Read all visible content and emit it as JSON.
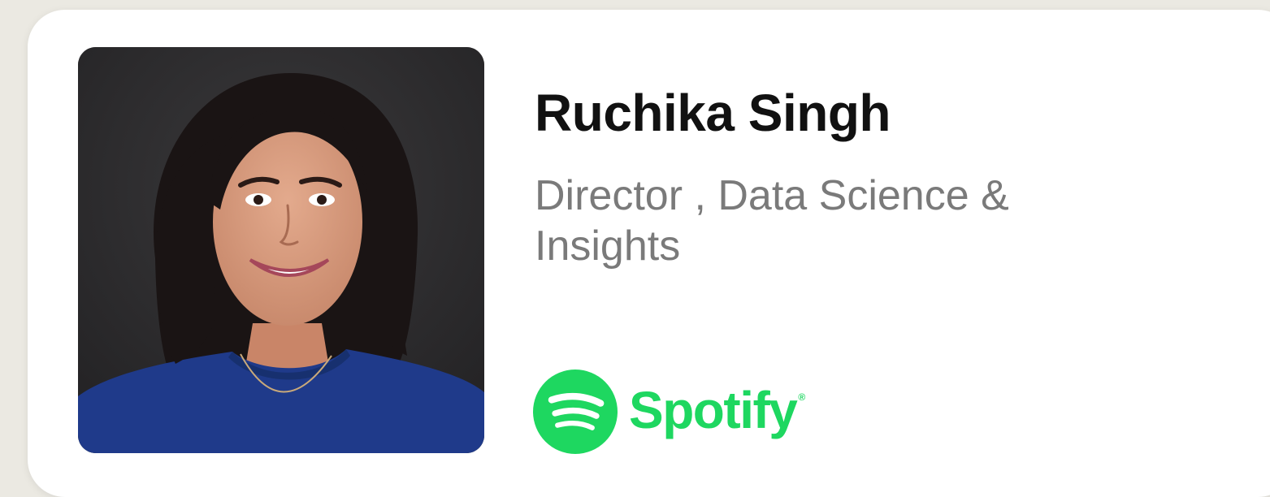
{
  "profile": {
    "name": "Ruchika Singh",
    "title": "Director , Data Science & Insights",
    "company": "Spotify",
    "company_logo_icon": "spotify-logo-icon",
    "photo_alt": "Portrait of Ruchika Singh"
  },
  "colors": {
    "background": "#ebe9e2",
    "card": "#ffffff",
    "name_text": "#111111",
    "title_text": "#7a7a7a",
    "spotify_green": "#1ed760",
    "photo_background": "#2f2e30",
    "shirt": "#1f3a8a"
  }
}
